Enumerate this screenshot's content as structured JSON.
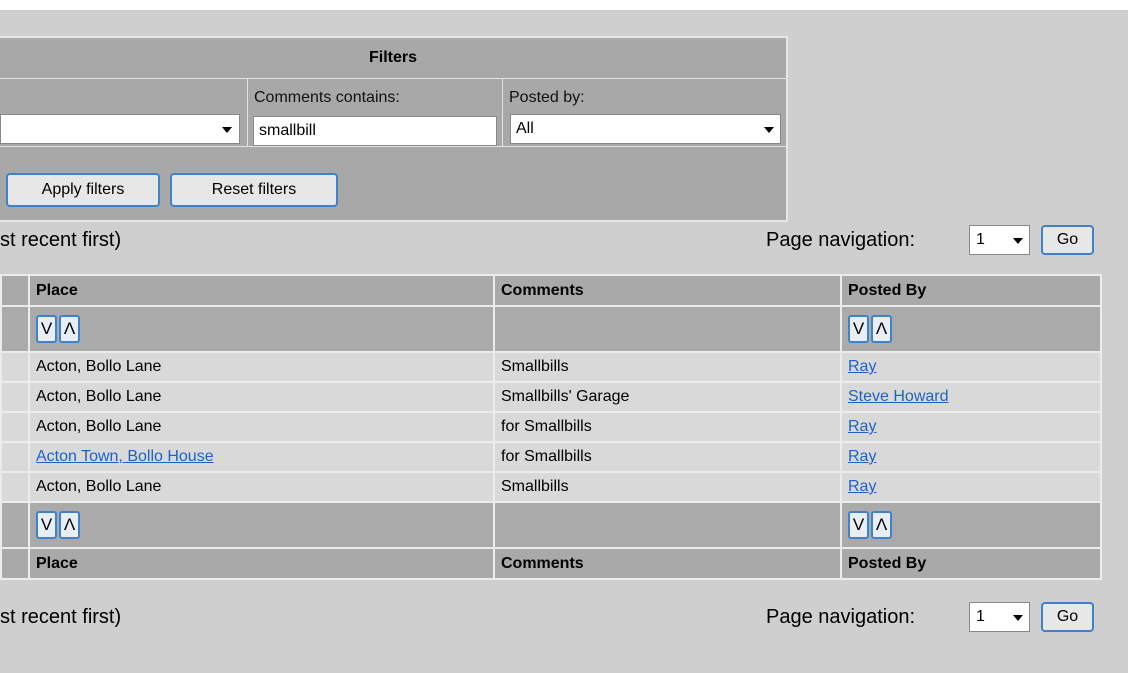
{
  "filters": {
    "title": "Filters",
    "comments_label": "Comments contains:",
    "comments_value": "smallbill",
    "posted_by_label": "Posted by:",
    "posted_by_value": "All",
    "apply_label": "Apply filters",
    "reset_label": "Reset filters"
  },
  "summary_text": "st recent first)",
  "page_nav": {
    "label": "Page navigation:",
    "page": "1",
    "go_label": "Go"
  },
  "table": {
    "headers": {
      "place": "Place",
      "comments": "Comments",
      "posted_by": "Posted By"
    },
    "sort": {
      "down": "V",
      "up": "Λ"
    },
    "rows": [
      {
        "place": "Acton, Bollo Lane",
        "comments": "Smallbills",
        "posted_by": "Ray"
      },
      {
        "place": "Acton, Bollo Lane",
        "comments": "Smallbills' Garage",
        "posted_by": "Steve Howard"
      },
      {
        "place": "Acton, Bollo Lane",
        "comments": "for Smallbills",
        "posted_by": "Ray"
      },
      {
        "place": "Acton Town, Bollo House",
        "comments": "for Smallbills",
        "posted_by": "Ray"
      },
      {
        "place": "Acton, Bollo Lane",
        "comments": "Smallbills",
        "posted_by": "Ray"
      }
    ]
  },
  "colors": {
    "accent": "#3f82c9",
    "link": "#1e62c9",
    "background": "#cfcfcf"
  }
}
